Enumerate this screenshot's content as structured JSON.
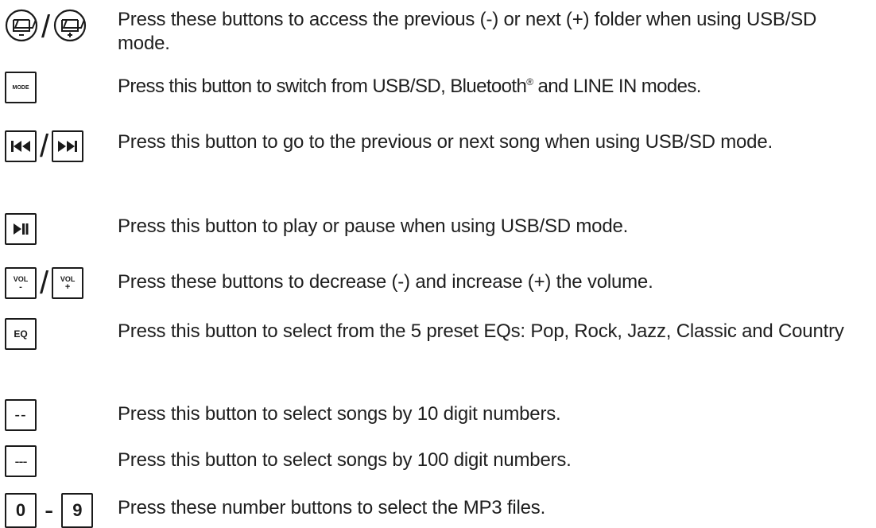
{
  "rows": [
    {
      "icons": {
        "separator": "/"
      },
      "text": "Press these buttons to access the previous (-) or next (+) folder when using USB/SD mode."
    },
    {
      "icons": {
        "label": "MODE"
      },
      "text_before": "Press this button to switch from USB/SD, Bluetooth",
      "sup": "®",
      "text_after": " and LINE IN modes."
    },
    {
      "icons": {
        "separator": "/"
      },
      "text": "Press this button to go to the previous or next song when using USB/SD mode."
    },
    {
      "text": "Press this button to play or pause when using USB/SD mode."
    },
    {
      "icons": {
        "label": "VOL",
        "minus": "-",
        "plus": "+",
        "separator": "/"
      },
      "text": "Press these buttons to decrease (-) and increase (+) the volume."
    },
    {
      "icons": {
        "label": "EQ"
      },
      "text": "Press this button to select from the 5 preset EQs: Pop, Rock, Jazz, Classic and Country"
    },
    {
      "icons": {
        "label": "--"
      },
      "text": "Press this button to select songs by 10 digit numbers."
    },
    {
      "icons": {
        "label": "---"
      },
      "text": "Press this button to select songs by 100 digit numbers."
    },
    {
      "icons": {
        "first": "0",
        "separator": "-",
        "last": "9"
      },
      "text": "Press these number buttons to select the MP3 files."
    }
  ],
  "icon_names": [
    "folder-minus-icon",
    "folder-plus-icon",
    "mode-button-icon",
    "previous-track-icon",
    "next-track-icon",
    "play-pause-icon",
    "vol-minus-icon",
    "vol-plus-icon",
    "eq-icon",
    "double-dash-icon",
    "triple-dash-icon",
    "digit-0-icon",
    "digit-9-icon"
  ]
}
